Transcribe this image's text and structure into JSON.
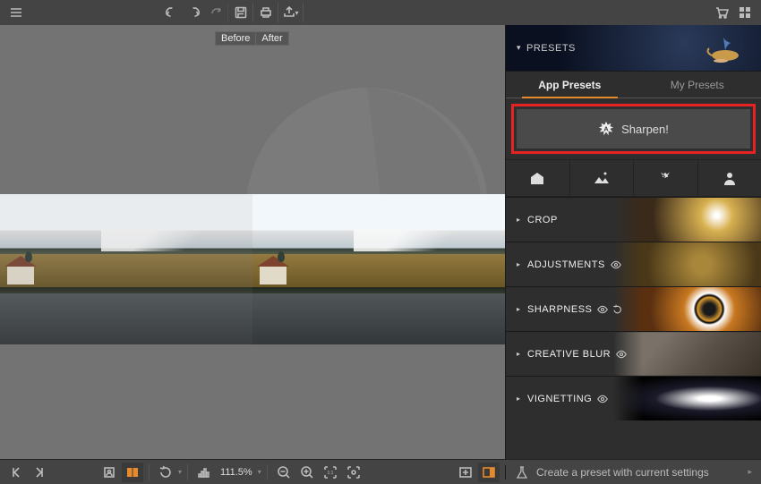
{
  "toolbar": {
    "menu": "menu",
    "cart": "cart",
    "grid": "grid"
  },
  "canvas": {
    "before_label": "Before",
    "after_label": "After"
  },
  "sidebar": {
    "presets": {
      "title": "PRESETS",
      "tabs": [
        "App Presets",
        "My Presets"
      ],
      "featured": "Sharpen!",
      "categories": [
        "architecture",
        "landscape",
        "macro",
        "portrait"
      ]
    },
    "sections": [
      {
        "label": "CROP",
        "eye": false,
        "reset": false
      },
      {
        "label": "ADJUSTMENTS",
        "eye": true,
        "reset": false
      },
      {
        "label": "SHARPNESS",
        "eye": true,
        "reset": true
      },
      {
        "label": "CREATIVE BLUR",
        "eye": true,
        "reset": false
      },
      {
        "label": "VIGNETTING",
        "eye": true,
        "reset": false
      }
    ]
  },
  "bottombar": {
    "zoom": "111.5%",
    "create_preset": "Create a preset with current settings"
  }
}
